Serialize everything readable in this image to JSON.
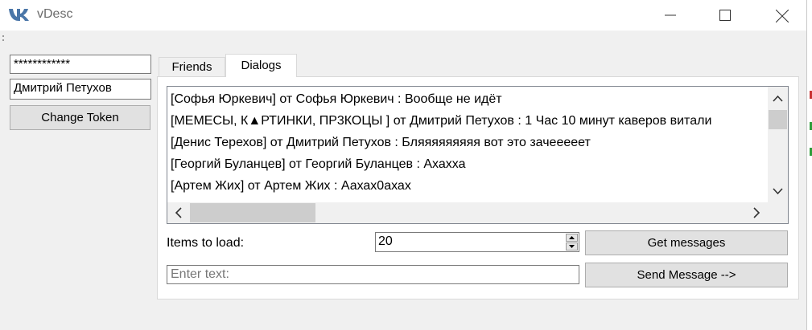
{
  "window": {
    "title": "vDesc",
    "logo_icon": "vk-logo-icon"
  },
  "left_panel": {
    "token_value": "************",
    "user_name": "Дмитрий Петухов",
    "change_token_label": "Change Token"
  },
  "tabs": [
    {
      "label": "Friends",
      "active": false
    },
    {
      "label": "Dialogs",
      "active": true
    }
  ],
  "dialogs": {
    "items": [
      "[Софья Юркевич] от Софья Юркевич : Вообще не идёт",
      "[МЕМЕСЫ, К▲РТИНКИ, ПР3КОЦЫ ] от Дмитрий Петухов : 1 Час 10 минут каверов витали",
      "[Денис Терехов] от Дмитрий Петухов : Бляяяяяяяяя вот это зачееееет",
      "[Георгий Буланцев] от Георгий Буланцев : Ахахха",
      "[Артем Жих] от Артем Жих : Аахах0ахах"
    ]
  },
  "controls": {
    "items_to_load_label": "Items to load:",
    "items_to_load_value": "20",
    "get_messages_label": "Get messages",
    "message_placeholder": "Enter text:",
    "send_message_label": "Send Message -->"
  },
  "colors": {
    "window_bg": "#f0f0f0",
    "button_bg": "#e1e1e1",
    "vk_blue": "#4a76a8",
    "edge_red": "#c83232",
    "edge_green": "#2e9d3a"
  }
}
